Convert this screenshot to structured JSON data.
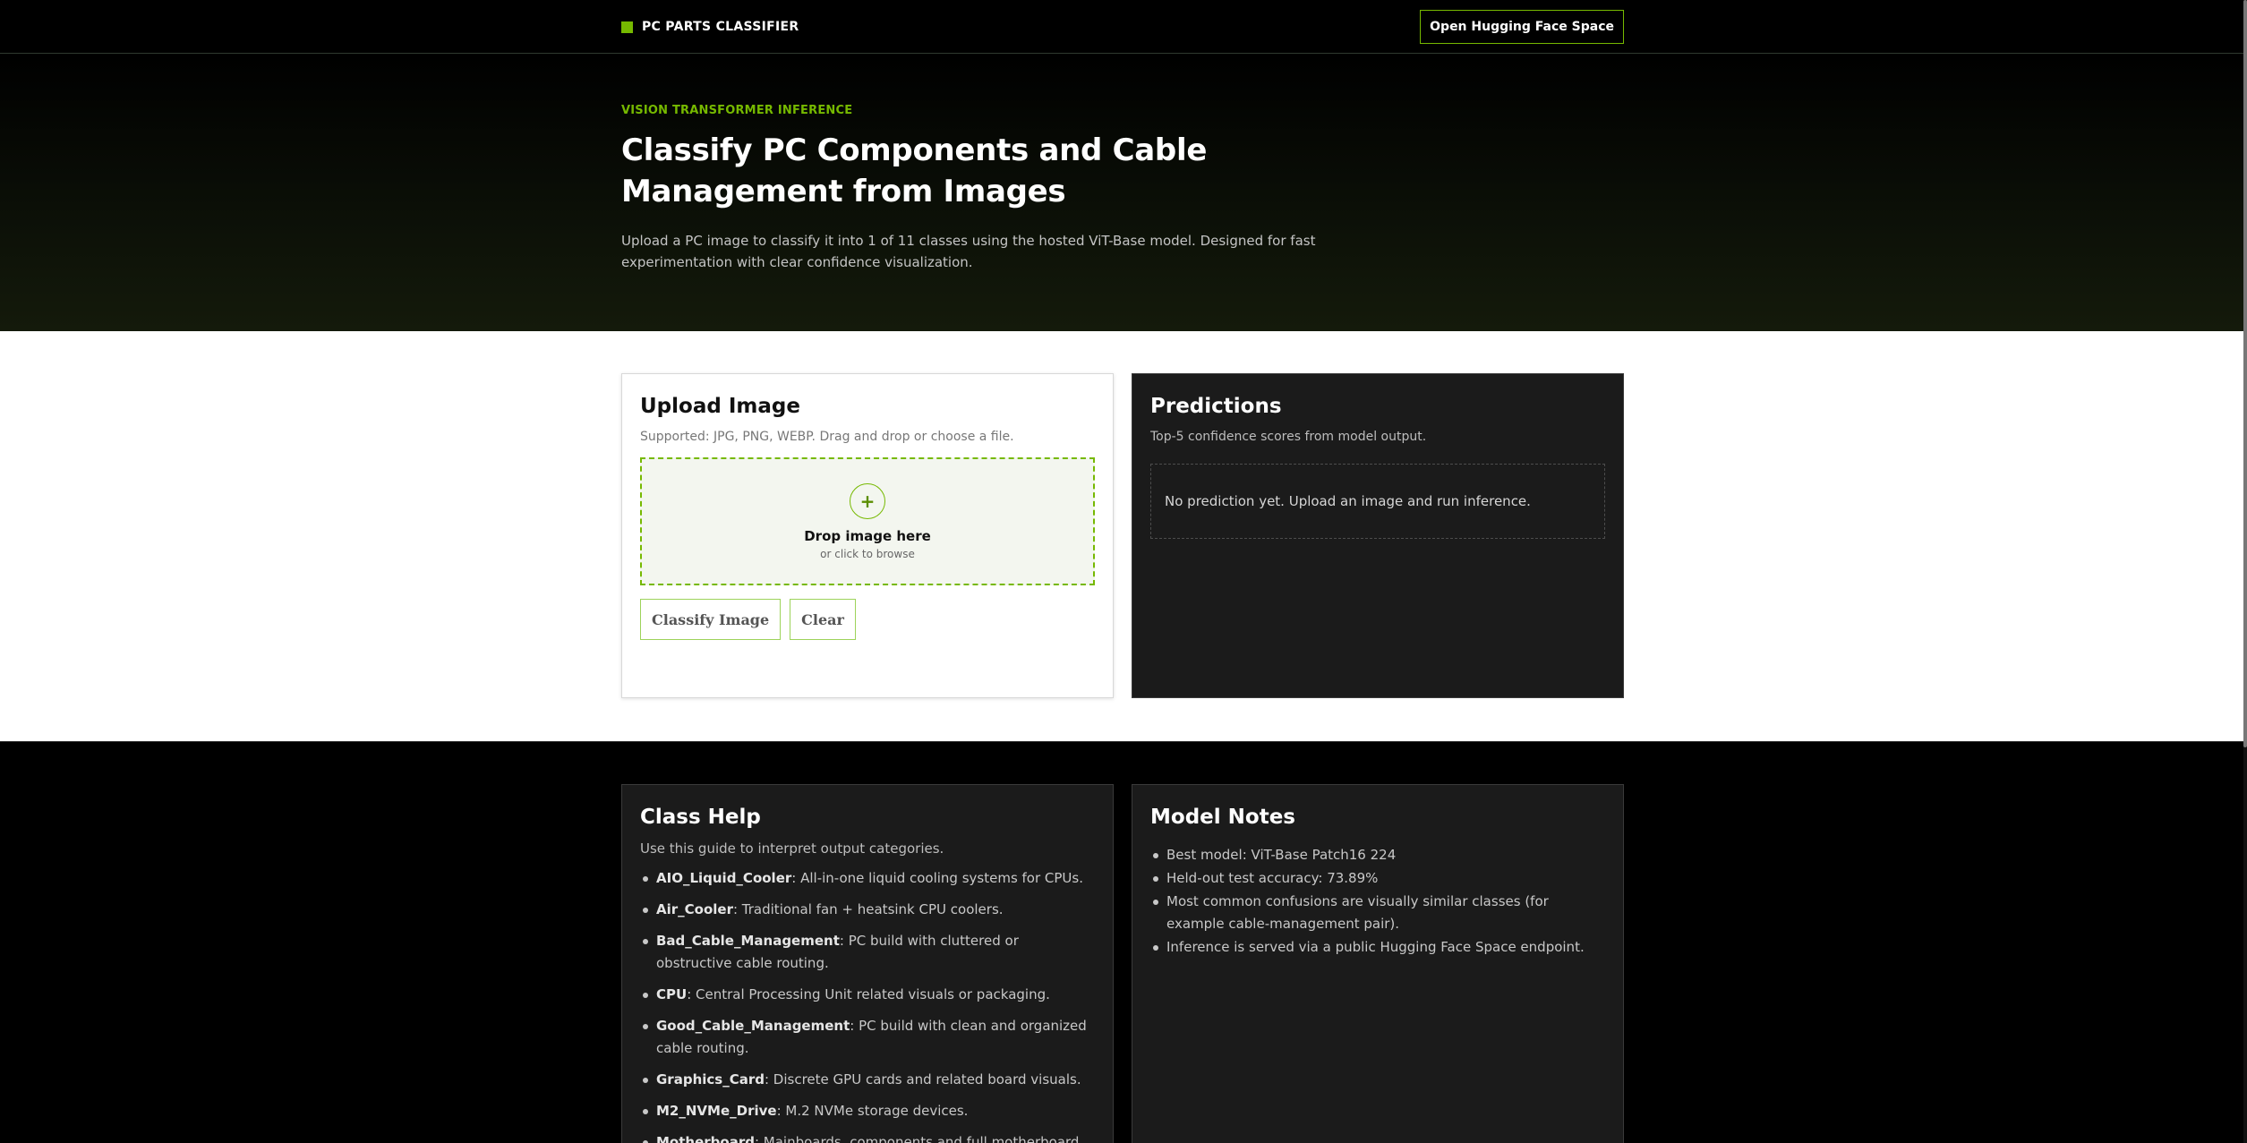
{
  "header": {
    "brand": "PC PARTS CLASSIFIER",
    "space_button": "Open Hugging Face Space"
  },
  "hero": {
    "eyebrow": "VISION TRANSFORMER INFERENCE",
    "title": "Classify PC Components and Cable Management from Images",
    "description": "Upload a PC image to classify it into 1 of 11 classes using the hosted ViT-Base model. Designed for fast experimentation with clear confidence visualization."
  },
  "upload": {
    "title": "Upload Image",
    "subtitle": "Supported: JPG, PNG, WEBP. Drag and drop or choose a file.",
    "drop_icon": "+",
    "drop_title": "Drop image here",
    "drop_sub": "or click to browse",
    "classify_button": "Classify Image",
    "clear_button": "Clear"
  },
  "predictions": {
    "title": "Predictions",
    "subtitle": "Top-5 confidence scores from model output.",
    "empty_text": "No prediction yet. Upload an image and run inference."
  },
  "class_help": {
    "title": "Class Help",
    "subtitle": "Use this guide to interpret output categories.",
    "items": [
      {
        "name": "AIO_Liquid_Cooler",
        "desc": ": All-in-one liquid cooling systems for CPUs."
      },
      {
        "name": "Air_Cooler",
        "desc": ": Traditional fan + heatsink CPU coolers."
      },
      {
        "name": "Bad_Cable_Management",
        "desc": ": PC build with cluttered or obstructive cable routing."
      },
      {
        "name": "CPU",
        "desc": ": Central Processing Unit related visuals or packaging."
      },
      {
        "name": "Good_Cable_Management",
        "desc": ": PC build with clean and organized cable routing."
      },
      {
        "name": "Graphics_Card",
        "desc": ": Discrete GPU cards and related board visuals."
      },
      {
        "name": "M2_NVMe_Drive",
        "desc": ": M.2 NVMe storage devices."
      },
      {
        "name": "Motherboard",
        "desc": ": Mainboards, components and full motherboard shots."
      }
    ]
  },
  "model_notes": {
    "title": "Model Notes",
    "items": [
      "Best model: ViT-Base Patch16 224",
      "Held-out test accuracy: 73.89%",
      "Most common confusions are visually similar classes (for example cable-management pair).",
      "Inference is served via a public Hugging Face Space endpoint."
    ]
  },
  "colors": {
    "accent": "#76b900",
    "background": "#000000",
    "card_dark": "#1b1b1b"
  }
}
